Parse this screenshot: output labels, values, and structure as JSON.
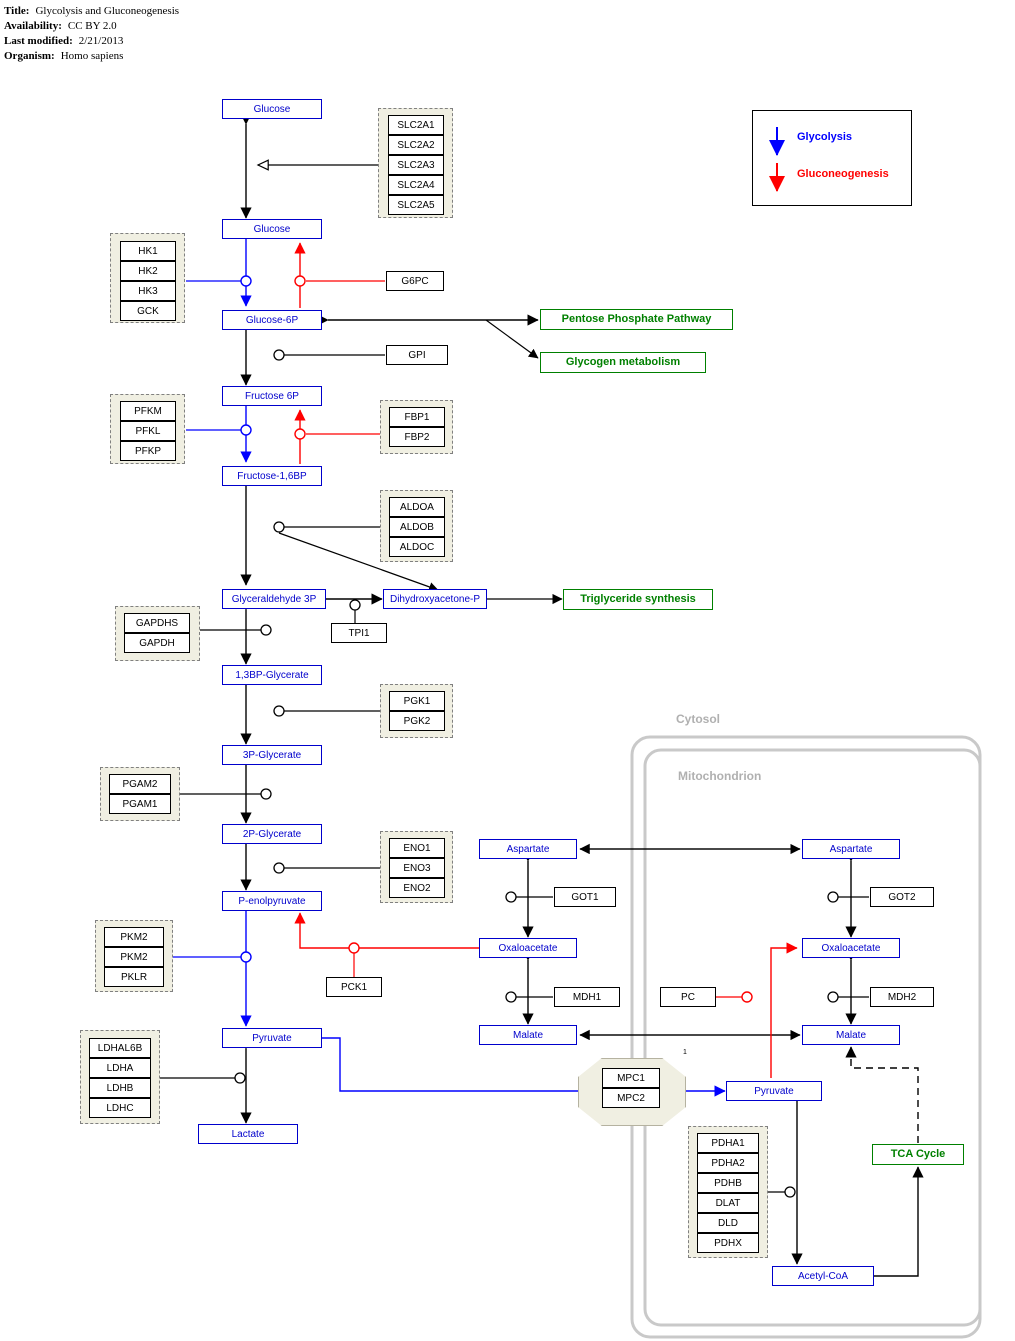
{
  "header": {
    "title_label": "Title:",
    "title_value": "Glycolysis and Gluconeogenesis",
    "availability_label": "Availability:",
    "availability_value": "CC BY 2.0",
    "last_modified_label": "Last modified:",
    "last_modified_value": "2/21/2013",
    "organism_label": "Organism:",
    "organism_value": "Homo sapiens"
  },
  "legend": {
    "glycolysis": "Glycolysis",
    "gluconeogenesis": "Gluconeogenesis",
    "glycolysis_color": "#0000ff",
    "gluconeogenesis_color": "#ff0000"
  },
  "compartments": {
    "cytosol": "Cytosol",
    "mitochondrion": "Mitochondrion",
    "mpc_superscript": "1"
  },
  "metabolites": {
    "glucose_extracellular": "Glucose",
    "glucose_cytosolic": "Glucose",
    "glucose6p": "Glucose-6P",
    "fructose6p": "Fructose 6P",
    "fructose16bp": "Fructose-1,6BP",
    "glyceraldehyde3p": "Glyceraldehyde 3P",
    "dhap": "Dihydroxyacetone-P",
    "bpg": "1,3BP-Glycerate",
    "pg3": "3P-Glycerate",
    "pg2": "2P-Glycerate",
    "pep": "P-enolpyruvate",
    "pyruvate": "Pyruvate",
    "lactate": "Lactate",
    "aspartate_cyt": "Aspartate",
    "oxaloacetate_cyt": "Oxaloacetate",
    "malate_cyt": "Malate",
    "aspartate_mito": "Aspartate",
    "oxaloacetate_mito": "Oxaloacetate",
    "malate_mito": "Malate",
    "pyruvate_mito": "Pyruvate",
    "acetyl_coa": "Acetyl-CoA"
  },
  "pathway_links": {
    "ppp": "Pentose Phosphate Pathway",
    "glycogen": "Glycogen metabolism",
    "triglyceride": "Triglyceride synthesis",
    "tca": "TCA Cycle"
  },
  "gene_groups": {
    "slc2a": [
      "SLC2A1",
      "SLC2A2",
      "SLC2A3",
      "SLC2A4",
      "SLC2A5"
    ],
    "hk": [
      "HK1",
      "HK2",
      "HK3",
      "GCK"
    ],
    "pfk": [
      "PFKM",
      "PFKL",
      "PFKP"
    ],
    "fbp": [
      "FBP1",
      "FBP2"
    ],
    "aldo": [
      "ALDOA",
      "ALDOB",
      "ALDOC"
    ],
    "gapdh": [
      "GAPDHS",
      "GAPDH"
    ],
    "pgk": [
      "PGK1",
      "PGK2"
    ],
    "pgam": [
      "PGAM2",
      "PGAM1"
    ],
    "eno": [
      "ENO1",
      "ENO3",
      "ENO2"
    ],
    "pk": [
      "PKM2",
      "PKM2",
      "PKLR"
    ],
    "ldh": [
      "LDHAL6B",
      "LDHA",
      "LDHB",
      "LDHC"
    ],
    "mpc": [
      "MPC1",
      "MPC2"
    ],
    "pdh": [
      "PDHA1",
      "PDHA2",
      "PDHB",
      "DLAT",
      "DLD",
      "PDHX"
    ]
  },
  "single_genes": {
    "g6pc": "G6PC",
    "gpi": "GPI",
    "tpi1": "TPI1",
    "pck1": "PCK1",
    "got1": "GOT1",
    "got2": "GOT2",
    "mdh1": "MDH1",
    "mdh2": "MDH2",
    "pc": "PC"
  }
}
